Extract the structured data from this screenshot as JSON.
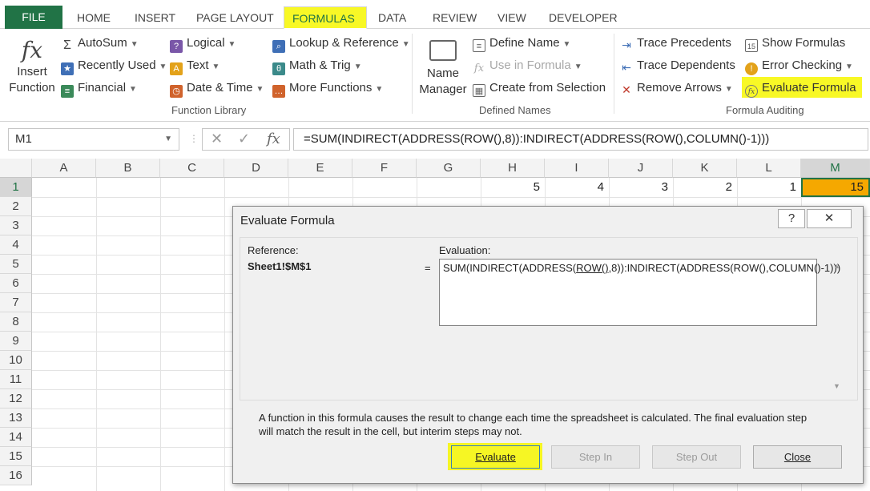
{
  "ribbon_tabs": [
    "FILE",
    "HOME",
    "INSERT",
    "PAGE LAYOUT",
    "FORMULAS",
    "DATA",
    "REVIEW",
    "VIEW",
    "DEVELOPER"
  ],
  "function_library": {
    "insert_function": [
      "Insert",
      "Function"
    ],
    "autosum": "AutoSum",
    "recently_used": "Recently Used",
    "financial": "Financial",
    "logical": "Logical",
    "text": "Text",
    "date_time": "Date & Time",
    "lookup_reference": "Lookup & Reference",
    "math_trig": "Math & Trig",
    "more_functions": "More Functions",
    "group_label": "Function Library"
  },
  "defined_names": {
    "name_manager": [
      "Name",
      "Manager"
    ],
    "define_name": "Define Name",
    "use_in_formula": "Use in Formula",
    "create_from_selection": "Create from Selection",
    "group_label": "Defined Names"
  },
  "formula_auditing": {
    "trace_precedents": "Trace Precedents",
    "trace_dependents": "Trace Dependents",
    "remove_arrows": "Remove Arrows",
    "show_formulas": "Show Formulas",
    "error_checking": "Error Checking",
    "evaluate_formula": "Evaluate Formula",
    "group_label": "Formula Auditing"
  },
  "formula_bar": {
    "name_box": "M1",
    "formula": "=SUM(INDIRECT(ADDRESS(ROW(),8)):INDIRECT(ADDRESS(ROW(),COLUMN()-1)))"
  },
  "columns": [
    "A",
    "B",
    "C",
    "D",
    "E",
    "F",
    "G",
    "H",
    "I",
    "J",
    "K",
    "L",
    "M"
  ],
  "rows": [
    "1",
    "2",
    "3",
    "4",
    "5",
    "6",
    "7",
    "8",
    "9",
    "10",
    "11",
    "12",
    "13",
    "14",
    "15",
    "16"
  ],
  "row1_values": {
    "H": "5",
    "I": "4",
    "J": "3",
    "K": "2",
    "L": "1",
    "M": "15"
  },
  "colors": {
    "excel_green": "#217346",
    "highlight": "#f7f700",
    "selected_cell": "#f5a800"
  },
  "dialog": {
    "title": "Evaluate Formula",
    "help": "?",
    "close_x": "✕",
    "reference_label": "Reference:",
    "reference_value": "Sheet1!$M$1",
    "equals": "=",
    "evaluation_label": "Evaluation:",
    "evaluation_pre": "SUM(INDIRECT(ADDRESS(",
    "evaluation_underlined": "ROW()",
    "evaluation_post": ",8)):INDIRECT(ADDRESS(ROW(),COLUMN()-1)))",
    "message": "A function in this formula causes the result to change each time the spreadsheet is calculated.  The final evaluation step will match the result in the cell, but interim steps may not.",
    "buttons": {
      "evaluate": "Evaluate",
      "step_in": "Step In",
      "step_out": "Step Out",
      "close": "Close"
    }
  }
}
